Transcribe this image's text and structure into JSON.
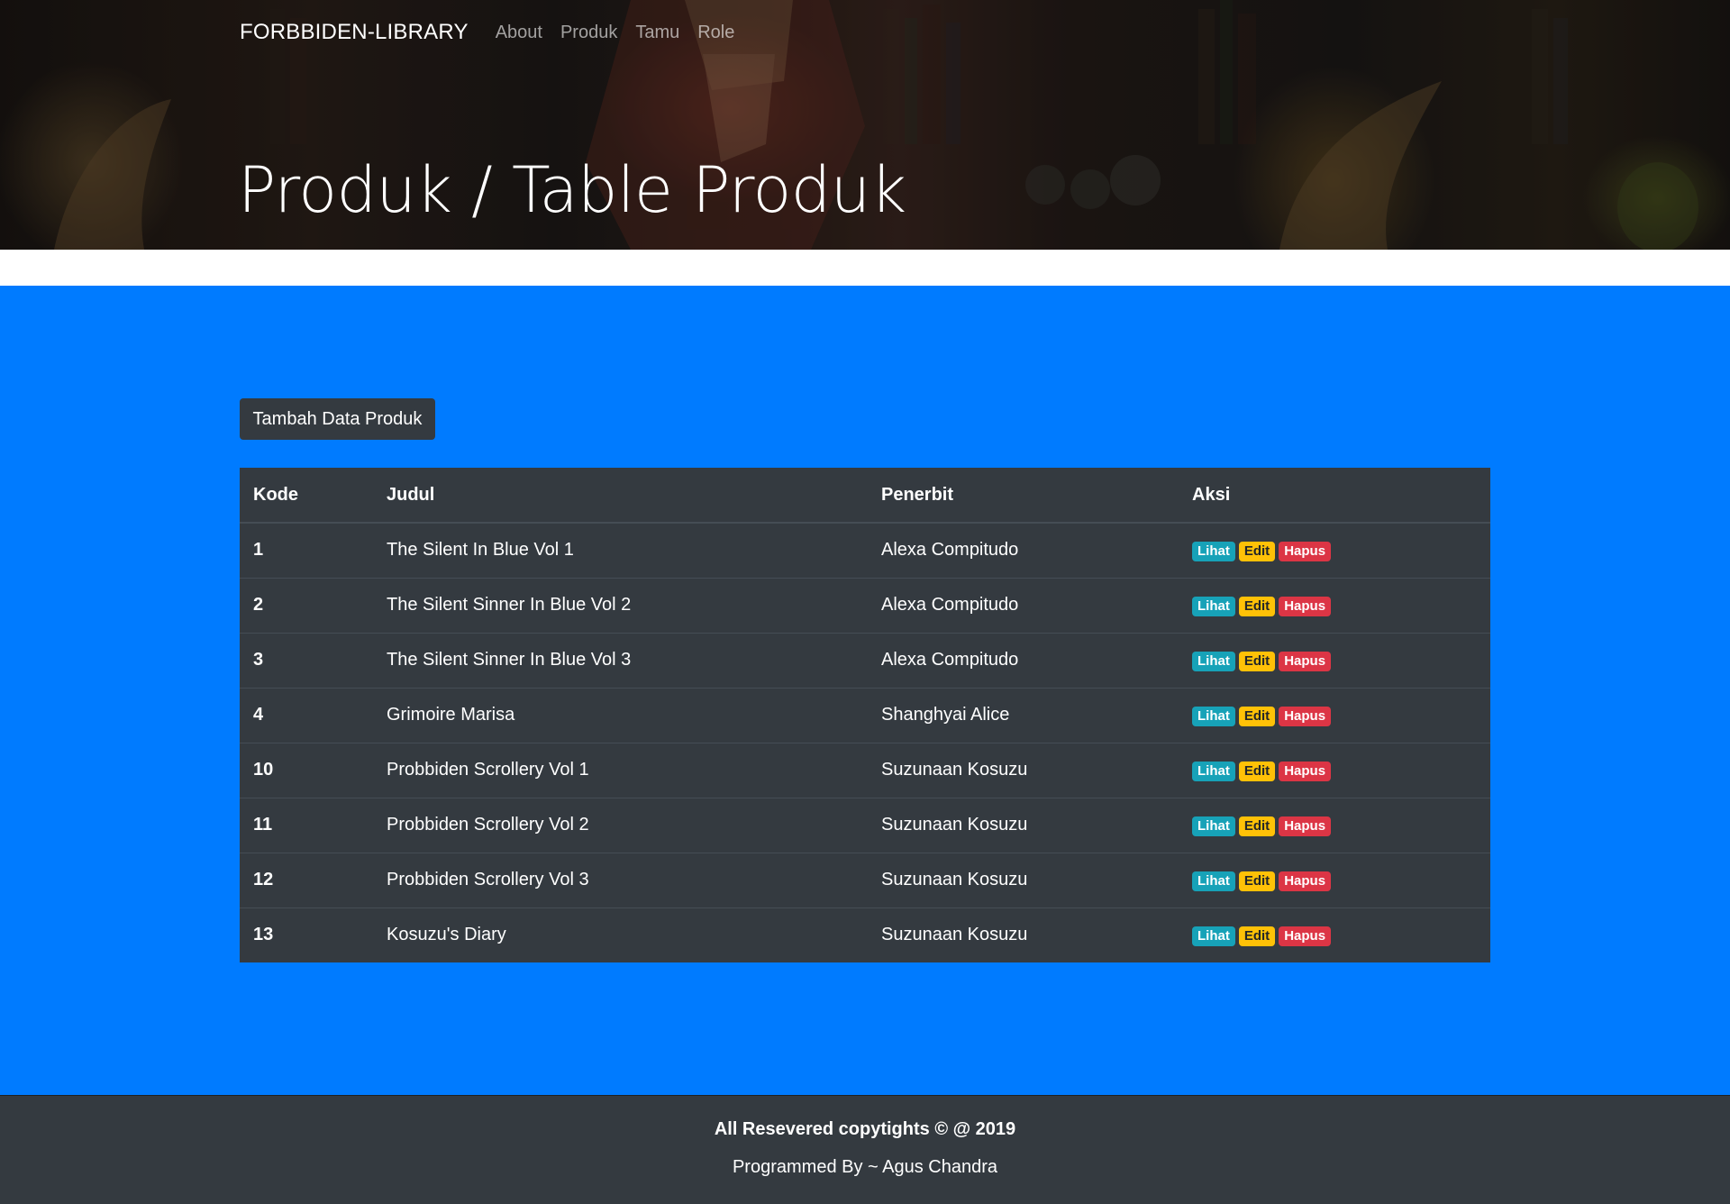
{
  "navbar": {
    "brand": "FORBBIDEN-LIBRARY",
    "links": [
      "About",
      "Produk",
      "Tamu",
      "Role"
    ]
  },
  "header": {
    "title": "Produk / Table Produk"
  },
  "main": {
    "add_button_label": "Tambah Data Produk"
  },
  "table": {
    "headers": [
      "Kode",
      "Judul",
      "Penerbit",
      "Aksi"
    ],
    "actions": [
      "Lihat",
      "Edit",
      "Hapus"
    ],
    "rows": [
      {
        "kode": "1",
        "judul": "The Silent In Blue Vol 1",
        "penerbit": "Alexa Compitudo"
      },
      {
        "kode": "2",
        "judul": "The Silent Sinner In Blue Vol 2",
        "penerbit": "Alexa Compitudo"
      },
      {
        "kode": "3",
        "judul": "The Silent Sinner In Blue Vol 3",
        "penerbit": "Alexa Compitudo"
      },
      {
        "kode": "4",
        "judul": "Grimoire Marisa",
        "penerbit": "Shanghyai Alice"
      },
      {
        "kode": "10",
        "judul": "Probbiden Scrollery Vol 1",
        "penerbit": "Suzunaan Kosuzu"
      },
      {
        "kode": "11",
        "judul": "Probbiden Scrollery Vol 2",
        "penerbit": "Suzunaan Kosuzu"
      },
      {
        "kode": "12",
        "judul": "Probbiden Scrollery Vol 3",
        "penerbit": "Suzunaan Kosuzu"
      },
      {
        "kode": "13",
        "judul": "Kosuzu's Diary",
        "penerbit": "Suzunaan Kosuzu"
      }
    ]
  },
  "footer": {
    "copyright": "All Resevered copytights © @ 2019",
    "author": "Programmed By ~ Agus Chandra"
  },
  "colors": {
    "main_background": "#007bff",
    "dark": "#343a40",
    "badge_lihat": "#17a2b8",
    "badge_edit": "#ffc107",
    "badge_hapus": "#dc3545"
  }
}
